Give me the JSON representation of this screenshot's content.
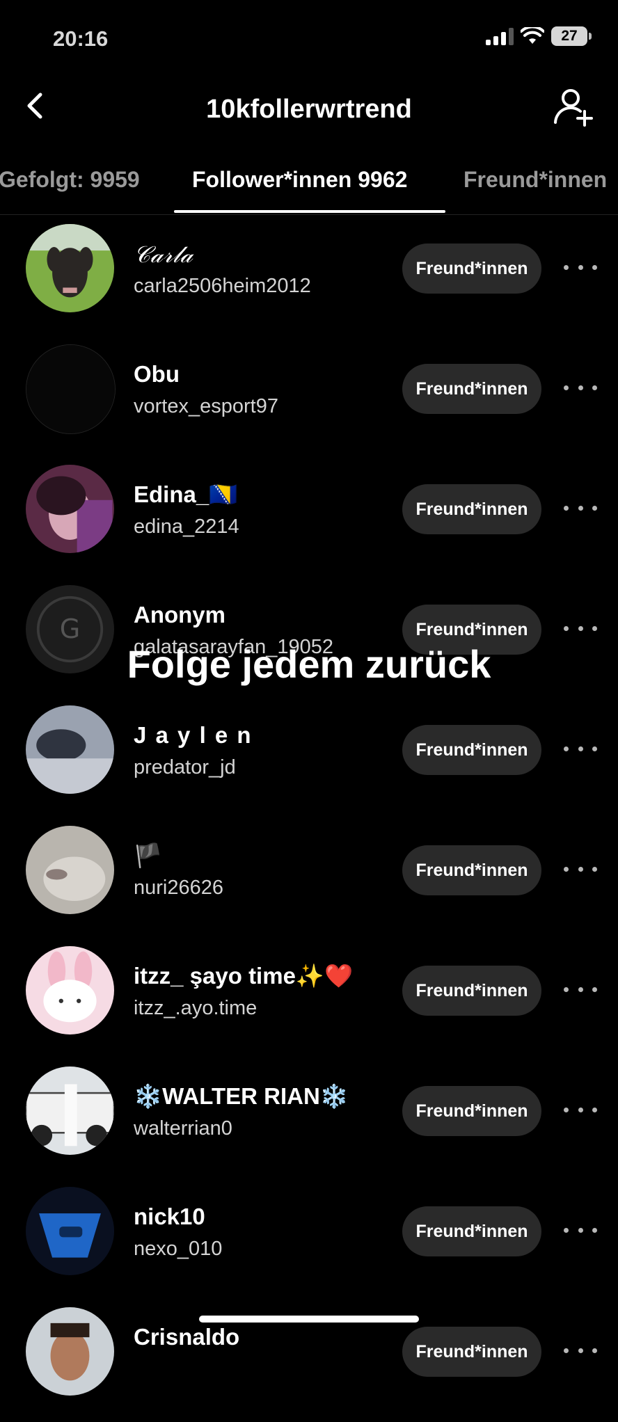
{
  "status": {
    "time": "20:16",
    "battery": "27"
  },
  "header": {
    "title": "10kfollerwrtrend"
  },
  "tabs": [
    {
      "label": "Gefolgt: 9959",
      "active": false
    },
    {
      "label": "Follower*innen 9962",
      "active": true
    },
    {
      "label": "Freund*innen",
      "active": false
    }
  ],
  "overlay_text": "Folge jedem zurück",
  "followers": [
    {
      "name": "𝒞𝒶𝓇𝓁𝒶",
      "handle": "carla2506heim2012",
      "button": "Freund*innen"
    },
    {
      "name": "Obu",
      "handle": "vortex_esport97",
      "button": "Freund*innen"
    },
    {
      "name": "Edina_🇧🇦",
      "handle": "edina_2214",
      "button": "Freund*innen"
    },
    {
      "name": "Anonym",
      "handle": "galatasarayfan_19052",
      "button": "Freund*innen"
    },
    {
      "name": "J a y l e n",
      "handle": "predator_jd",
      "button": "Freund*innen"
    },
    {
      "name": "🏴",
      "handle": "nuri26626",
      "button": "Freund*innen"
    },
    {
      "name": "itzz_ şayo time✨❤️",
      "handle": "itzz_.ayo.time",
      "button": "Freund*innen"
    },
    {
      "name": "❄️WALTER RIAN❄️",
      "handle": "walterrian0",
      "button": "Freund*innen"
    },
    {
      "name": "nick10",
      "handle": "nexo_010",
      "button": "Freund*innen"
    },
    {
      "name": "Crisnaldo",
      "handle": "",
      "button": "Freund*innen"
    }
  ]
}
